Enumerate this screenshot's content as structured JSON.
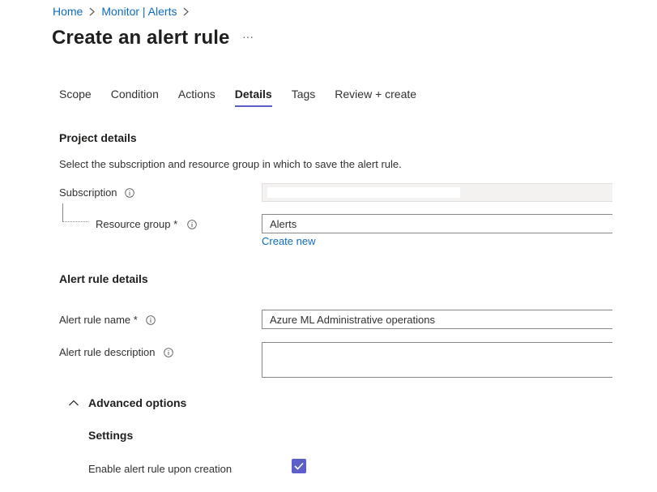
{
  "breadcrumb": {
    "items": [
      "Home",
      "Monitor | Alerts"
    ]
  },
  "page": {
    "title": "Create an alert rule",
    "more": "···"
  },
  "tabs": [
    {
      "label": "Scope",
      "active": false
    },
    {
      "label": "Condition",
      "active": false
    },
    {
      "label": "Actions",
      "active": false
    },
    {
      "label": "Details",
      "active": true
    },
    {
      "label": "Tags",
      "active": false
    },
    {
      "label": "Review + create",
      "active": false
    }
  ],
  "project_details": {
    "title": "Project details",
    "description": "Select the subscription and resource group in which to save the alert rule.",
    "subscription_label": "Subscription",
    "subscription_value": "",
    "resource_group_label": "Resource group *",
    "resource_group_value": "Alerts",
    "create_new": "Create new"
  },
  "alert_rule_details": {
    "title": "Alert rule details",
    "name_label": "Alert rule name *",
    "name_value": "Azure ML Administrative operations",
    "description_label": "Alert rule description",
    "description_value": ""
  },
  "advanced": {
    "toggle_label": "Advanced options",
    "settings_title": "Settings",
    "enable_label": "Enable alert rule upon creation",
    "enable_checked": true
  },
  "colors": {
    "accent": "#5b5fc7",
    "link": "#0f6cbd"
  }
}
